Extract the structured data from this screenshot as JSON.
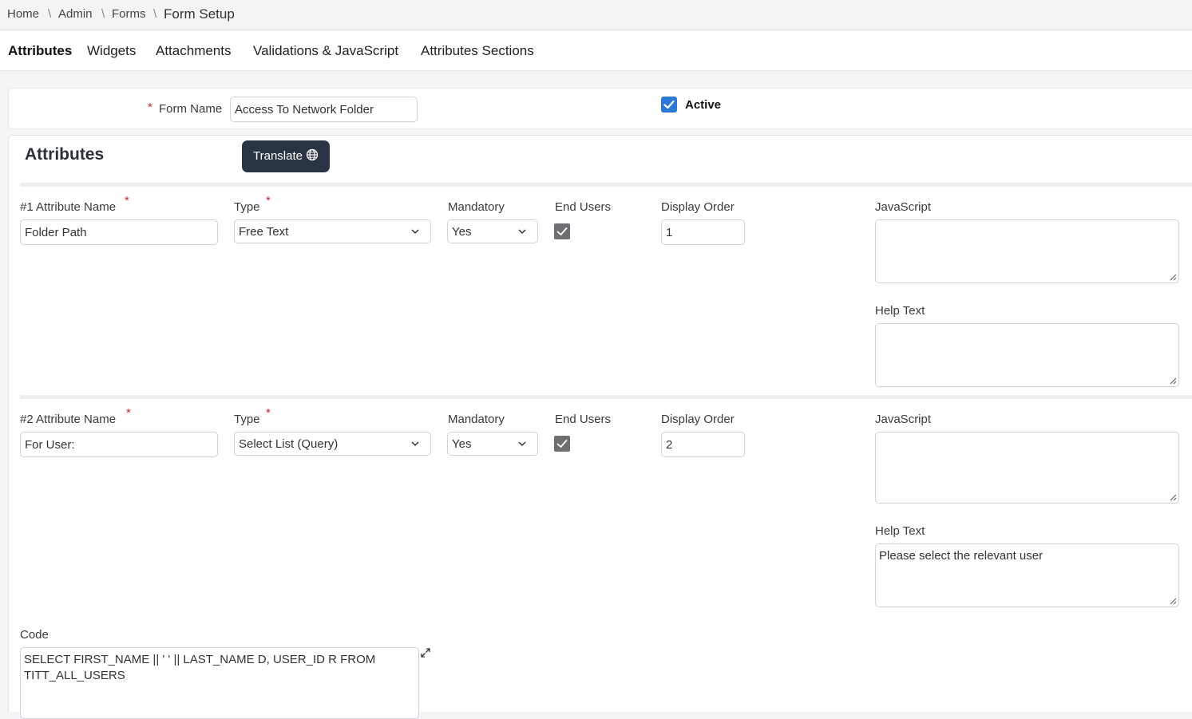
{
  "breadcrumb": {
    "home": "Home",
    "admin": "Admin",
    "forms": "Forms",
    "current": "Form Setup",
    "separator": "\\"
  },
  "tabs": [
    "Attributes",
    "Widgets",
    "Attachments",
    "Validations & JavaScript",
    "Attributes Sections"
  ],
  "form": {
    "name_label": "Form Name",
    "name_value": "Access To Network Folder",
    "active_label": "Active",
    "required_mark": "*"
  },
  "attributes_section": {
    "title": "Attributes",
    "translate_label": "Translate"
  },
  "attributes": [
    {
      "name_label": "#1 Attribute Name",
      "name_value": "Folder Path",
      "type_label": "Type",
      "type_value": "Free Text",
      "mandatory_label": "Mandatory",
      "mandatory_value": "Yes",
      "end_users_label": "End Users",
      "display_order_label": "Display Order",
      "display_order_value": "1",
      "javascript_label": "JavaScript",
      "javascript_value": "",
      "help_text_label": "Help Text",
      "help_text_value": ""
    },
    {
      "name_label": "#2 Attribute Name",
      "name_value": "For User:",
      "type_label": "Type",
      "type_value": "Select List (Query)",
      "mandatory_label": "Mandatory",
      "mandatory_value": "Yes",
      "end_users_label": "End Users",
      "display_order_label": "Display Order",
      "display_order_value": "2",
      "javascript_label": "JavaScript",
      "javascript_value": "",
      "help_text_label": "Help Text",
      "help_text_value": "Please select the relevant user",
      "code_label": "Code",
      "code_value": "SELECT FIRST_NAME || ' ' || LAST_NAME D, USER_ID R FROM TITT_ALL_USERS"
    }
  ],
  "colors": {
    "accent": "#2b78d6",
    "button_bg": "#2b3445",
    "required": "#d4232d"
  },
  "icons": [
    "globe-icon",
    "chevron-down-icon",
    "check-icon",
    "resize-handle-icon",
    "expand-icon"
  ]
}
